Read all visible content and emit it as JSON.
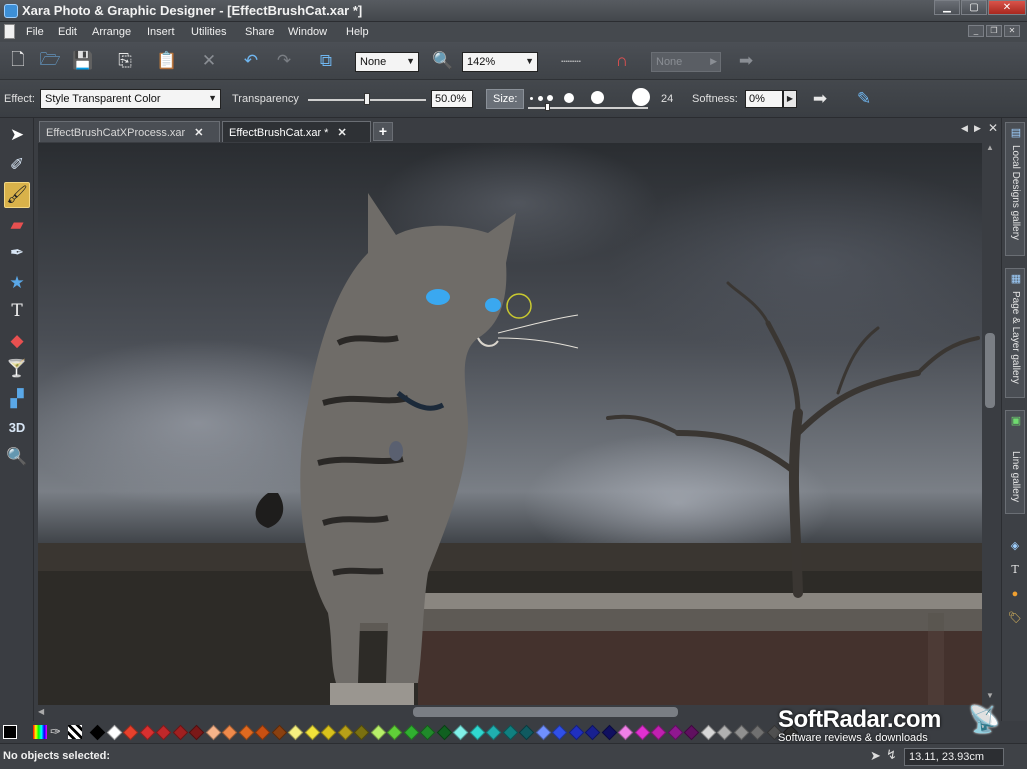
{
  "window": {
    "title": "Xara Photo & Graphic Designer - [EffectBrushCat.xar *]"
  },
  "menubar": {
    "items": [
      "File",
      "Edit",
      "Arrange",
      "Insert",
      "Utilities",
      "Share",
      "Window",
      "Help"
    ]
  },
  "toolbar": {
    "fill_combo": "None",
    "zoom_combo": "142%",
    "disabled_combo": "None"
  },
  "effect_bar": {
    "effect_label": "Effect:",
    "effect_value": "Style Transparent Color",
    "transparency_label": "Transparency",
    "transparency_value": "50.0%",
    "transparency_level": 0.5,
    "size_button": "Size:",
    "size_value": "24",
    "softness_label": "Softness:",
    "softness_value": "0%"
  },
  "tabs": [
    {
      "label": "EffectBrushCatXProcess.xar",
      "active": false
    },
    {
      "label": "EffectBrushCat.xar *",
      "active": true
    }
  ],
  "gallery": {
    "tabs": [
      "Local Designs gallery",
      "Page & Layer gallery",
      "Line gallery"
    ]
  },
  "palette": {
    "colors": [
      "#000000",
      "#ffffff",
      "#e8412c",
      "#d93030",
      "#c0282a",
      "#a02020",
      "#7a1818",
      "#f7b48a",
      "#f08a4b",
      "#e06a20",
      "#c95012",
      "#8a4010",
      "#f6f080",
      "#f1e23a",
      "#d9c21c",
      "#b8a018",
      "#7a7010",
      "#b8f06a",
      "#60d038",
      "#30b030",
      "#208a2a",
      "#106020",
      "#80f0e8",
      "#30d8d0",
      "#20b0b0",
      "#108080",
      "#105a60",
      "#7090ff",
      "#3050e8",
      "#2030c0",
      "#182090",
      "#101060",
      "#f080e8",
      "#e030d0",
      "#c020b0",
      "#901890",
      "#601060",
      "#d8d8d8",
      "#b0b0b0",
      "#909090",
      "#707070",
      "#505050",
      "#303030"
    ]
  },
  "status": {
    "message": "No objects selected:",
    "coordinates": "13.11, 23.93cm"
  },
  "watermark": {
    "title": "SoftRadar.com",
    "subtitle": "Software reviews & downloads"
  }
}
